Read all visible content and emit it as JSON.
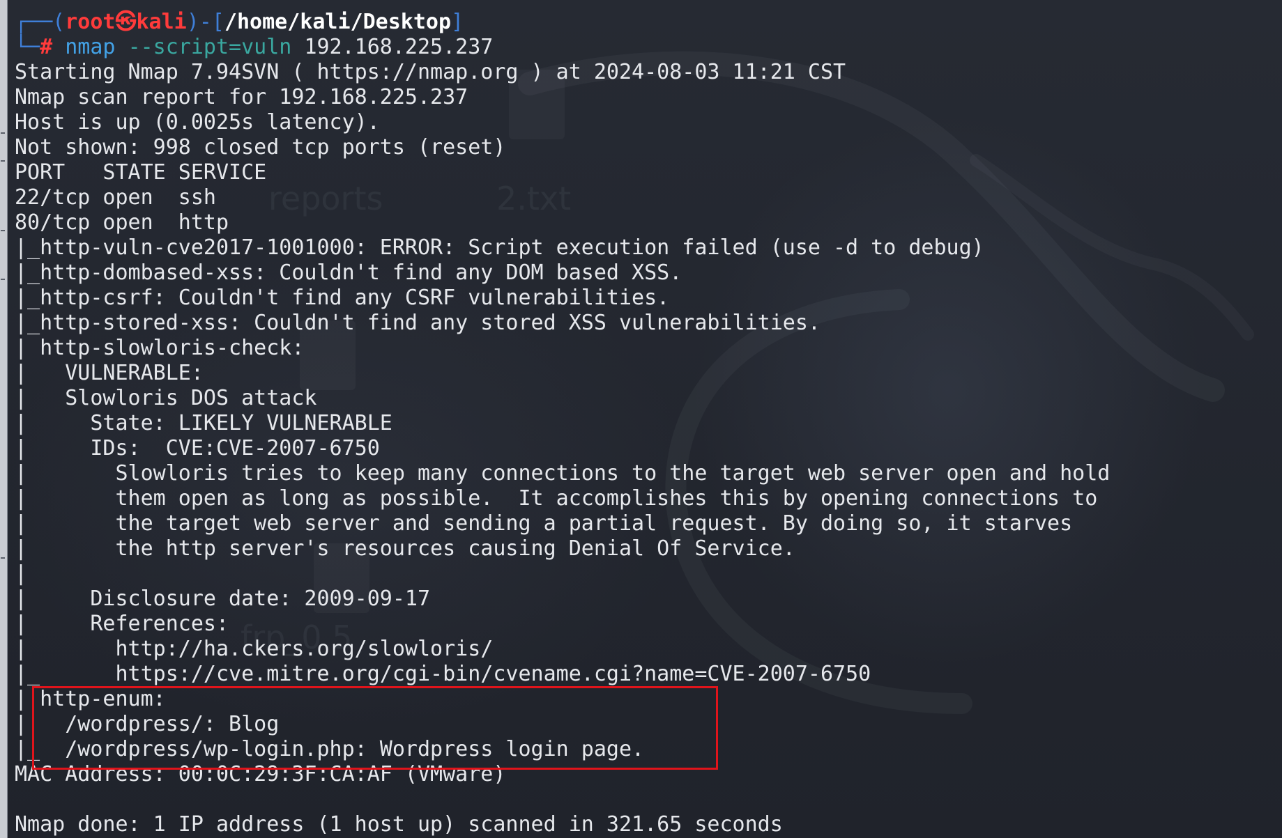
{
  "theme": {
    "background": "#23262f",
    "prompt_frame_color": "#3f7fd8",
    "prompt_user_color": "#ff3b3b",
    "command_color": "#43a2e6",
    "option_color": "#3aa8a0",
    "output_color": "#e6e8ec",
    "highlight_color": "#e0141b"
  },
  "prompt": {
    "frame_open": "┌──(",
    "user": "root",
    "separator": "㉿",
    "host": "kali",
    "frame_mid": ")-[",
    "path": "/home/kali/Desktop",
    "frame_close": "]",
    "frame_lower": "└─",
    "hash": "#",
    "command": "nmap",
    "option": "--script=vuln",
    "argument": "192.168.225.237"
  },
  "output_lines": [
    "Starting Nmap 7.94SVN ( https://nmap.org ) at 2024-08-03 11:21 CST",
    "Nmap scan report for 192.168.225.237",
    "Host is up (0.0025s latency).",
    "Not shown: 998 closed tcp ports (reset)",
    "PORT   STATE SERVICE",
    "22/tcp open  ssh",
    "80/tcp open  http",
    "|_http-vuln-cve2017-1001000: ERROR: Script execution failed (use -d to debug)",
    "|_http-dombased-xss: Couldn't find any DOM based XSS.",
    "|_http-csrf: Couldn't find any CSRF vulnerabilities.",
    "|_http-stored-xss: Couldn't find any stored XSS vulnerabilities.",
    "| http-slowloris-check: ",
    "|   VULNERABLE:",
    "|   Slowloris DOS attack",
    "|     State: LIKELY VULNERABLE",
    "|     IDs:  CVE:CVE-2007-6750",
    "|       Slowloris tries to keep many connections to the target web server open and hold",
    "|       them open as long as possible.  It accomplishes this by opening connections to",
    "|       the target web server and sending a partial request. By doing so, it starves",
    "|       the http server's resources causing Denial Of Service.",
    "|       ",
    "|     Disclosure date: 2009-09-17",
    "|     References:",
    "|       http://ha.ckers.org/slowloris/",
    "|_      https://cve.mitre.org/cgi-bin/cvename.cgi?name=CVE-2007-6750",
    "| http-enum: ",
    "|   /wordpress/: Blog",
    "|_  /wordpress/wp-login.php: Wordpress login page.",
    "MAC Address: 00:0C:29:3F:CA:AF (VMware)",
    "",
    "Nmap done: 1 IP address (1 host up) scanned in 321.65 seconds"
  ],
  "wallpaper_labels": {
    "file_1": "reports",
    "file_2": "2.txt",
    "file_3": "frp_0.5"
  }
}
